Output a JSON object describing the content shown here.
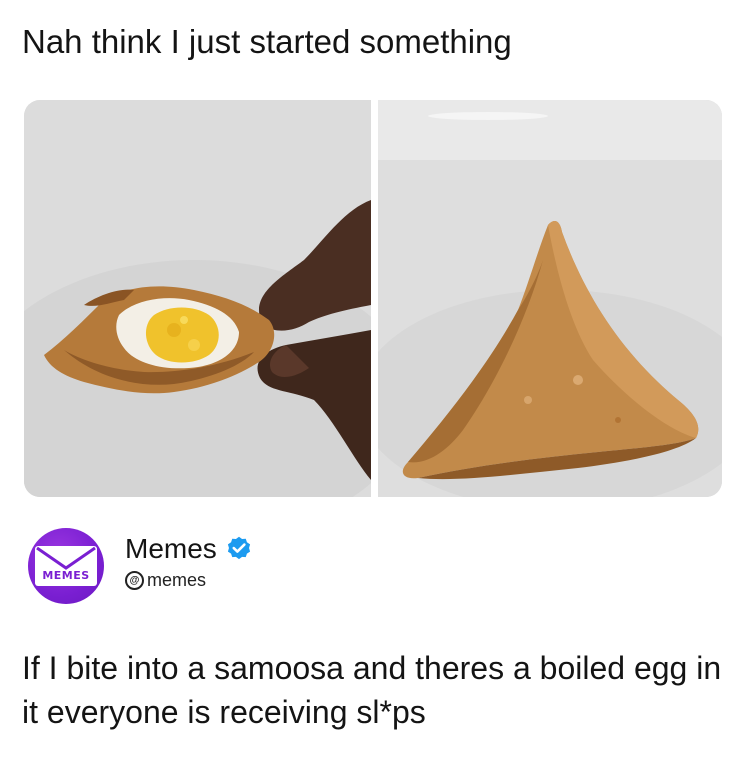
{
  "post": {
    "title": "Nah think I just started something",
    "body": "If I bite into a samoosa and theres a boiled egg in it everyone is receiving sl*ps"
  },
  "images": [
    {
      "description_icon": "samoosa-egg-photo"
    },
    {
      "description_icon": "samoosa-whole-photo"
    }
  ],
  "author": {
    "name": "Memes",
    "handle": "memes",
    "avatar_text": "MEMES",
    "verified": true
  },
  "colors": {
    "brand_purple": "#7a1fd2",
    "verified_blue": "#1d9bf0",
    "text": "#141414"
  }
}
